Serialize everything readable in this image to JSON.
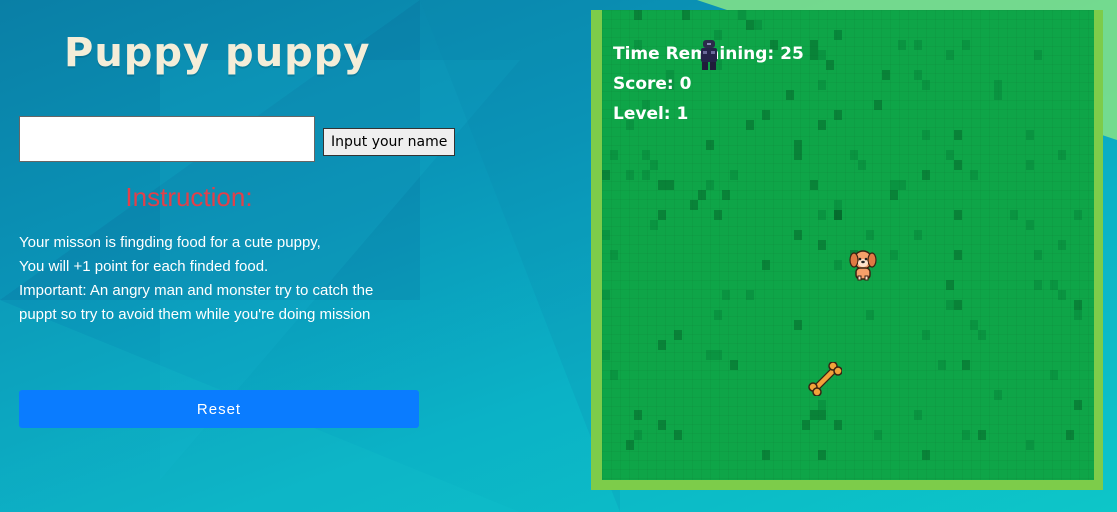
{
  "title": "Puppy puppy",
  "name_input": {
    "value": "",
    "placeholder": ""
  },
  "name_button": "Input your name",
  "instructions": {
    "heading": "Instruction:",
    "lines": [
      "Your misson is fingding food for a cute puppy,",
      "You will +1 point for each finded food.",
      "Important: An angry man and monster try to catch the",
      "puppt so try to avoid them while you're doing mission"
    ]
  },
  "reset_button": "Reset",
  "game": {
    "hud": {
      "time_remaining_label": "Time Remaining: 25",
      "score_label": "Score: 0",
      "level_label": "Level: 1"
    },
    "sprites": {
      "player_icon": "puppy-icon",
      "food_icon": "bone-icon",
      "enemy_icon": "angry-man-icon"
    }
  },
  "colors": {
    "title": "#f4edd8",
    "instruction_heading": "#e1404a",
    "reset_button": "#0a7cff",
    "grass": "#0ea548",
    "board_border": "#7dcc4a"
  }
}
